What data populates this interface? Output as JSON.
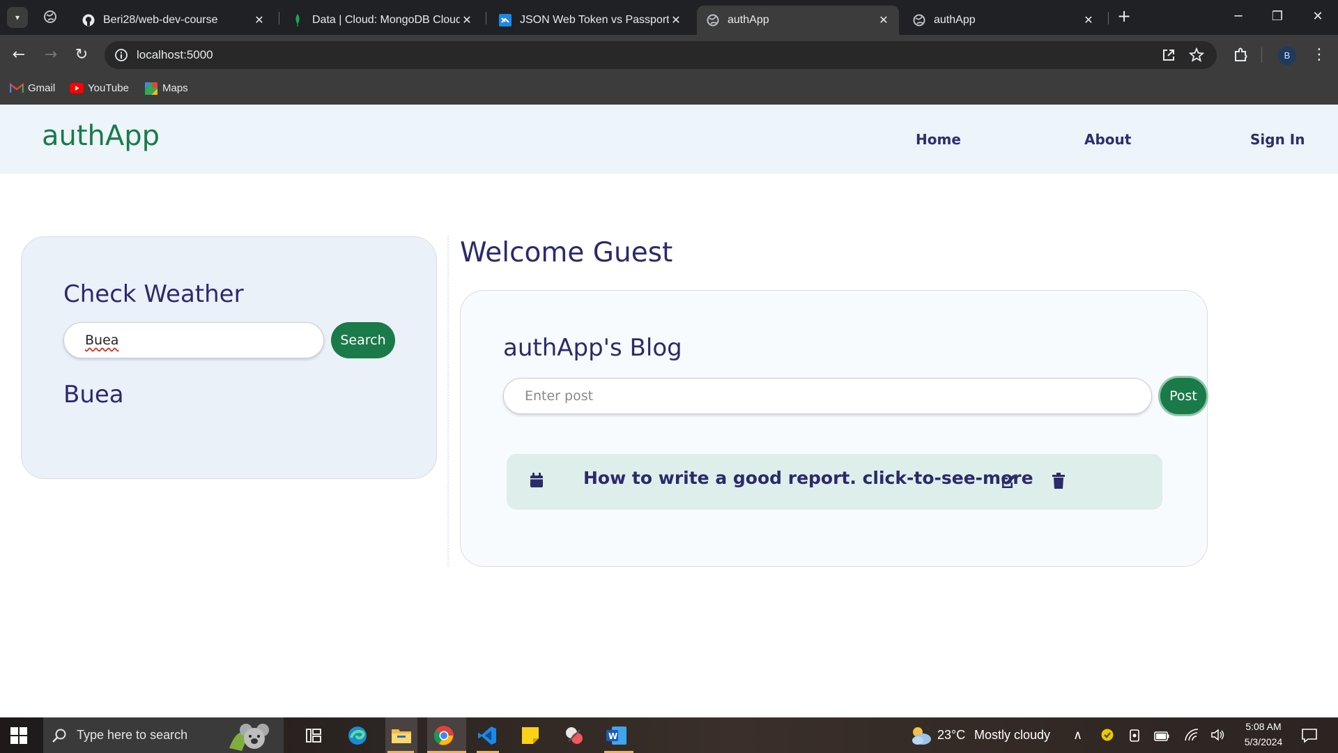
{
  "browser": {
    "tabs": [
      {
        "title": "Beri28/web-dev-course",
        "favicon": "github-icon"
      },
      {
        "title": "Data | Cloud: MongoDB Cloud",
        "favicon": "mongodb-leaf-icon"
      },
      {
        "title": "JSON Web Token vs Passport | V",
        "favicon": "vscode-icon"
      },
      {
        "title": "authApp",
        "favicon": "globe-icon",
        "active": true
      },
      {
        "title": "authApp",
        "favicon": "globe-icon"
      }
    ],
    "close_glyph": "✕",
    "new_tab_glyph": "+",
    "url": "localhost:5000",
    "profile_initial": "B",
    "bookmarks": [
      {
        "label": "Gmail",
        "icon": "gmail-icon"
      },
      {
        "label": "YouTube",
        "icon": "youtube-icon"
      },
      {
        "label": "Maps",
        "icon": "maps-icon"
      }
    ]
  },
  "site": {
    "brand": "authApp",
    "nav": {
      "home": "Home",
      "about": "About",
      "signin": "Sign In"
    },
    "weather": {
      "title": "Check Weather",
      "input_value": "Buea",
      "search_label": "Search",
      "result_city": "Buea"
    },
    "welcome": "Welcome Guest",
    "blog": {
      "title": "authApp's Blog",
      "post_placeholder": "Enter post",
      "post_label": "Post",
      "posts": [
        {
          "title": "How to write a good report. click-to-see-more"
        }
      ]
    },
    "colors": {
      "brand_green": "#1b7a49",
      "heading_navy": "#2b2a6b",
      "header_bg": "#edf4fa",
      "post_bg": "#deeeea"
    }
  },
  "taskbar": {
    "search_placeholder": "Type here to search",
    "weather_temp": "23°C",
    "weather_desc": "Mostly cloudy",
    "time": "5:08 AM",
    "date": "5/3/2024",
    "apps": [
      "task-view-icon",
      "edge-icon",
      "file-explorer-icon",
      "chrome-icon",
      "vscode-icon",
      "sticky-notes-icon",
      "snip-sketch-icon",
      "word-icon"
    ]
  }
}
